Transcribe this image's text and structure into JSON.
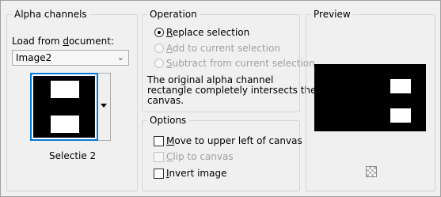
{
  "alpha_channels": {
    "title": "Alpha channels",
    "load_label_pre": "Load from ",
    "load_label_u": "d",
    "load_label_post": "ocument:",
    "document_value": "Image2",
    "thumbnail_name": "Selectie 2"
  },
  "operation": {
    "title": "Operation",
    "options": [
      {
        "u": "R",
        "rest": "eplace selection",
        "selected": true,
        "enabled": true
      },
      {
        "u": "A",
        "rest": "dd to current selection",
        "selected": false,
        "enabled": false
      },
      {
        "u": "S",
        "rest": "ubtract from current selection",
        "selected": false,
        "enabled": false
      }
    ],
    "message": [
      "The original alpha channel",
      "rectangle completely intersects the",
      "canvas."
    ]
  },
  "options": {
    "title": "Options",
    "items": [
      {
        "u": "M",
        "rest": "ove to upper left of canvas",
        "checked": false,
        "enabled": true
      },
      {
        "u": "C",
        "rest": "lip to canvas",
        "checked": false,
        "enabled": false
      },
      {
        "u": "I",
        "rest": "nvert image",
        "checked": false,
        "enabled": true
      }
    ]
  },
  "preview": {
    "title": "Preview"
  },
  "colors": {
    "accent": "#0078d7",
    "preview_bg": "#000000",
    "shape_fill": "#ffffff"
  }
}
